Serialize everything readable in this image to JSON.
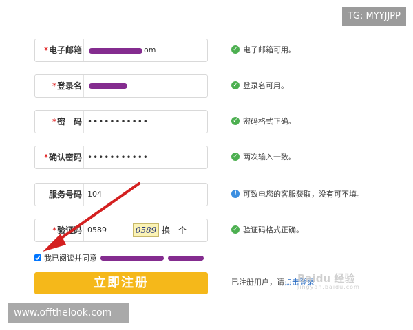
{
  "overlay": {
    "tg_label": "TG: MYYJJPP",
    "site_label": "www.offthelook.com",
    "watermark": "Baidu 经验",
    "watermark_sub": "jingyan.baidu.com"
  },
  "form": {
    "email": {
      "label": "电子邮箱",
      "value_tail": "om",
      "hint": "电子邮箱可用。"
    },
    "username": {
      "label": "登录名",
      "hint": "登录名可用。"
    },
    "password": {
      "label": "密　码",
      "value": "•••••••••••",
      "hint": "密码格式正确。"
    },
    "confirm": {
      "label": "确认密码",
      "value": "•••••••••••",
      "hint": "两次输入一致。"
    },
    "service": {
      "label": "服务号码",
      "value": "104",
      "hint": "可致电您的客服获取，没有可不填。"
    },
    "captcha": {
      "label": "验证码",
      "value": "0589",
      "image_text": "0589",
      "refresh_label": "换一个",
      "hint": "验证码格式正确。"
    },
    "agree_text": "我已阅读并同意",
    "register_button": "立即注册",
    "already_text": "已注册用户，请",
    "login_link": "点击登录"
  },
  "colors": {
    "accent": "#f5b81a",
    "ok": "#4caf50",
    "info": "#3b8ee0",
    "required": "#dd0000",
    "arrow": "#d42020"
  }
}
